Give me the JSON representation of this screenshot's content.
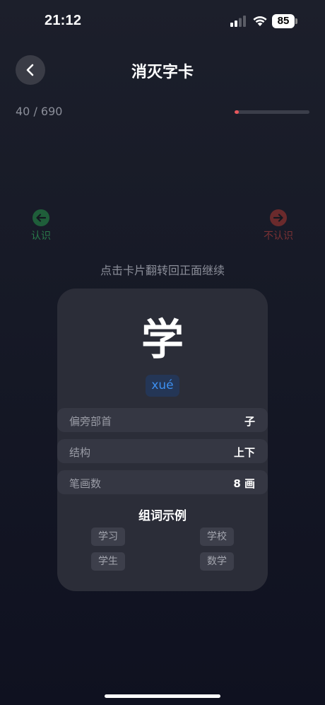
{
  "status_bar": {
    "time": "21:12",
    "battery": "85"
  },
  "header": {
    "title": "消灭字卡",
    "back_icon": "chevron-left-icon"
  },
  "progress": {
    "text": "40 / 690",
    "current": 40,
    "total": 690,
    "fraction": 0.058,
    "color": "#e8575c"
  },
  "swipe": {
    "left_label": "认识",
    "left_icon": "arrow-left-icon",
    "left_color": "#2a7a4b",
    "right_label": "不认识",
    "right_icon": "arrow-right-icon",
    "right_color": "#7a3134"
  },
  "flip_hint": "点击卡片翻转回正面继续",
  "card": {
    "character": "学",
    "pinyin": "xué",
    "rows": [
      {
        "label": "偏旁部首",
        "value": "子"
      },
      {
        "label": "结构",
        "value": "上下"
      },
      {
        "label": "笔画数",
        "value": "8 画"
      }
    ],
    "words_title": "组词示例",
    "words": [
      "学习",
      "学校",
      "学生",
      "数学"
    ]
  }
}
